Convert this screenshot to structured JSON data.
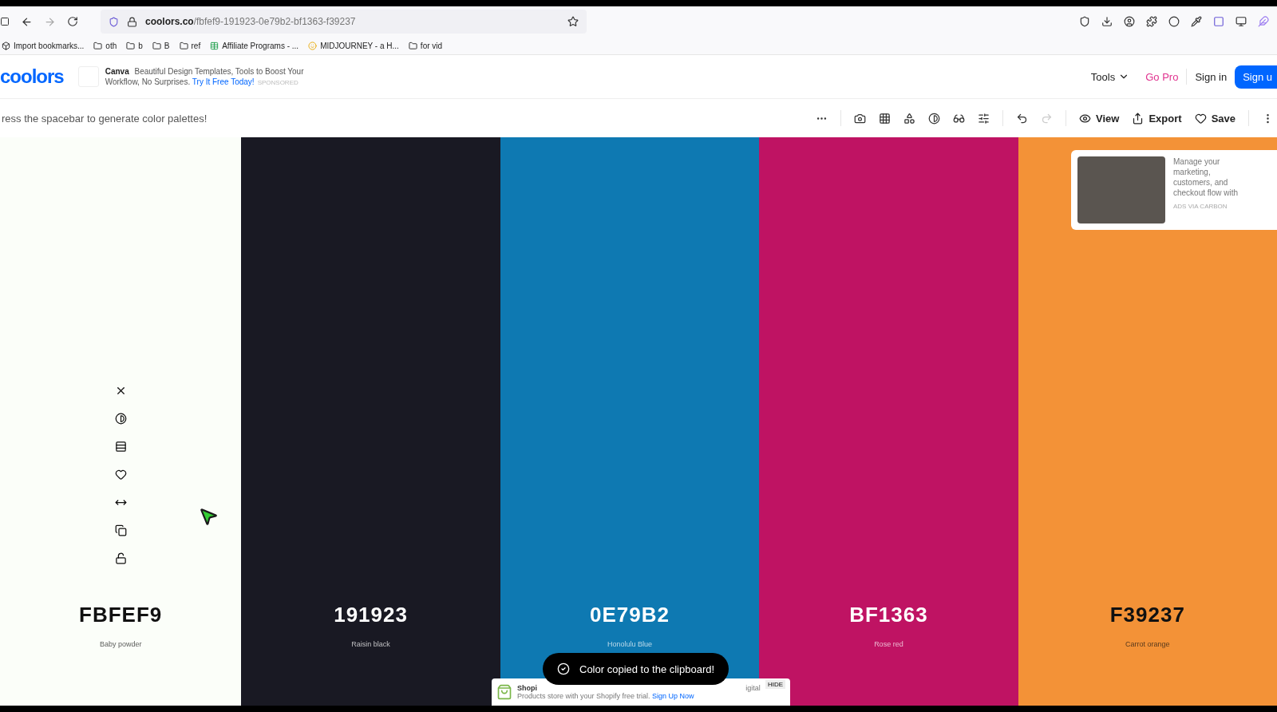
{
  "browser": {
    "url_host": "coolors.co",
    "url_path": "/fbfef9-191923-0e79b2-bf1363-f39237"
  },
  "bookmarks": [
    {
      "label": "Import bookmarks...",
      "kind": "import"
    },
    {
      "label": "oth",
      "kind": "folder"
    },
    {
      "label": "b",
      "kind": "folder"
    },
    {
      "label": "B",
      "kind": "folder"
    },
    {
      "label": "ref",
      "kind": "folder"
    },
    {
      "label": "Affiliate Programs - ...",
      "kind": "sheet"
    },
    {
      "label": "MIDJOURNEY - a H...",
      "kind": "emoji"
    },
    {
      "label": "for vid",
      "kind": "folder"
    }
  ],
  "header": {
    "logo": "coolors",
    "ad": {
      "brand": "Canva",
      "text": "Beautiful Design Templates, Tools to Boost Your Workflow, No Surprises.",
      "link": "Try It Free Today!",
      "tag": "SPONSORED"
    },
    "tools": "Tools",
    "go_pro": "Go Pro",
    "sign_in": "Sign in",
    "sign_up": "Sign u"
  },
  "toolbar": {
    "hint": "ress the spacebar to generate color palettes!",
    "view": "View",
    "export": "Export",
    "save": "Save"
  },
  "palette": [
    {
      "code": "FBFEF9",
      "name": "Baby powder",
      "color": "#fbfef9",
      "tools_shown": true
    },
    {
      "code": "191923",
      "name": "Raisin black",
      "color": "#191923",
      "tools_shown": false
    },
    {
      "code": "0E79B2",
      "name": "Honolulu Blue",
      "color": "#0e79b2",
      "tools_shown": false
    },
    {
      "code": "BF1363",
      "name": "Rose red",
      "color": "#bf1363",
      "tools_shown": false
    },
    {
      "code": "F39237",
      "name": "Carrot orange",
      "color": "#f39237",
      "tools_shown": false
    }
  ],
  "side_ad": {
    "text": "Manage your marketing, customers, and checkout flow with",
    "via": "ADS VIA CARBON"
  },
  "bottom_ad": {
    "title": "Shopi",
    "title_tail": "igital",
    "text": "Products store with your Shopify free trial.",
    "link": "Sign Up Now",
    "hide": "HIDE"
  },
  "toast": {
    "message": "Color copied to the clipboard!"
  }
}
